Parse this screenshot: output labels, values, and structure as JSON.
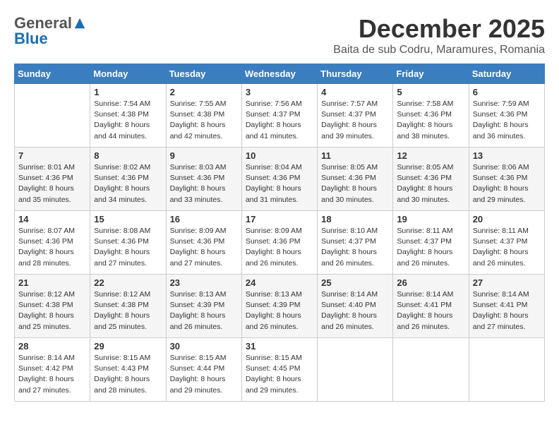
{
  "header": {
    "logo_general": "General",
    "logo_blue": "Blue",
    "month_title": "December 2025",
    "subtitle": "Baita de sub Codru, Maramures, Romania"
  },
  "weekdays": [
    "Sunday",
    "Monday",
    "Tuesday",
    "Wednesday",
    "Thursday",
    "Friday",
    "Saturday"
  ],
  "weeks": [
    [
      {
        "day": "",
        "info": ""
      },
      {
        "day": "1",
        "info": "Sunrise: 7:54 AM\nSunset: 4:38 PM\nDaylight: 8 hours\nand 44 minutes."
      },
      {
        "day": "2",
        "info": "Sunrise: 7:55 AM\nSunset: 4:38 PM\nDaylight: 8 hours\nand 42 minutes."
      },
      {
        "day": "3",
        "info": "Sunrise: 7:56 AM\nSunset: 4:37 PM\nDaylight: 8 hours\nand 41 minutes."
      },
      {
        "day": "4",
        "info": "Sunrise: 7:57 AM\nSunset: 4:37 PM\nDaylight: 8 hours\nand 39 minutes."
      },
      {
        "day": "5",
        "info": "Sunrise: 7:58 AM\nSunset: 4:36 PM\nDaylight: 8 hours\nand 38 minutes."
      },
      {
        "day": "6",
        "info": "Sunrise: 7:59 AM\nSunset: 4:36 PM\nDaylight: 8 hours\nand 36 minutes."
      }
    ],
    [
      {
        "day": "7",
        "info": "Sunrise: 8:01 AM\nSunset: 4:36 PM\nDaylight: 8 hours\nand 35 minutes."
      },
      {
        "day": "8",
        "info": "Sunrise: 8:02 AM\nSunset: 4:36 PM\nDaylight: 8 hours\nand 34 minutes."
      },
      {
        "day": "9",
        "info": "Sunrise: 8:03 AM\nSunset: 4:36 PM\nDaylight: 8 hours\nand 33 minutes."
      },
      {
        "day": "10",
        "info": "Sunrise: 8:04 AM\nSunset: 4:36 PM\nDaylight: 8 hours\nand 31 minutes."
      },
      {
        "day": "11",
        "info": "Sunrise: 8:05 AM\nSunset: 4:36 PM\nDaylight: 8 hours\nand 30 minutes."
      },
      {
        "day": "12",
        "info": "Sunrise: 8:05 AM\nSunset: 4:36 PM\nDaylight: 8 hours\nand 30 minutes."
      },
      {
        "day": "13",
        "info": "Sunrise: 8:06 AM\nSunset: 4:36 PM\nDaylight: 8 hours\nand 29 minutes."
      }
    ],
    [
      {
        "day": "14",
        "info": "Sunrise: 8:07 AM\nSunset: 4:36 PM\nDaylight: 8 hours\nand 28 minutes."
      },
      {
        "day": "15",
        "info": "Sunrise: 8:08 AM\nSunset: 4:36 PM\nDaylight: 8 hours\nand 27 minutes."
      },
      {
        "day": "16",
        "info": "Sunrise: 8:09 AM\nSunset: 4:36 PM\nDaylight: 8 hours\nand 27 minutes."
      },
      {
        "day": "17",
        "info": "Sunrise: 8:09 AM\nSunset: 4:36 PM\nDaylight: 8 hours\nand 26 minutes."
      },
      {
        "day": "18",
        "info": "Sunrise: 8:10 AM\nSunset: 4:37 PM\nDaylight: 8 hours\nand 26 minutes."
      },
      {
        "day": "19",
        "info": "Sunrise: 8:11 AM\nSunset: 4:37 PM\nDaylight: 8 hours\nand 26 minutes."
      },
      {
        "day": "20",
        "info": "Sunrise: 8:11 AM\nSunset: 4:37 PM\nDaylight: 8 hours\nand 26 minutes."
      }
    ],
    [
      {
        "day": "21",
        "info": "Sunrise: 8:12 AM\nSunset: 4:38 PM\nDaylight: 8 hours\nand 25 minutes."
      },
      {
        "day": "22",
        "info": "Sunrise: 8:12 AM\nSunset: 4:38 PM\nDaylight: 8 hours\nand 25 minutes."
      },
      {
        "day": "23",
        "info": "Sunrise: 8:13 AM\nSunset: 4:39 PM\nDaylight: 8 hours\nand 26 minutes."
      },
      {
        "day": "24",
        "info": "Sunrise: 8:13 AM\nSunset: 4:39 PM\nDaylight: 8 hours\nand 26 minutes."
      },
      {
        "day": "25",
        "info": "Sunrise: 8:14 AM\nSunset: 4:40 PM\nDaylight: 8 hours\nand 26 minutes."
      },
      {
        "day": "26",
        "info": "Sunrise: 8:14 AM\nSunset: 4:41 PM\nDaylight: 8 hours\nand 26 minutes."
      },
      {
        "day": "27",
        "info": "Sunrise: 8:14 AM\nSunset: 4:41 PM\nDaylight: 8 hours\nand 27 minutes."
      }
    ],
    [
      {
        "day": "28",
        "info": "Sunrise: 8:14 AM\nSunset: 4:42 PM\nDaylight: 8 hours\nand 27 minutes."
      },
      {
        "day": "29",
        "info": "Sunrise: 8:15 AM\nSunset: 4:43 PM\nDaylight: 8 hours\nand 28 minutes."
      },
      {
        "day": "30",
        "info": "Sunrise: 8:15 AM\nSunset: 4:44 PM\nDaylight: 8 hours\nand 29 minutes."
      },
      {
        "day": "31",
        "info": "Sunrise: 8:15 AM\nSunset: 4:45 PM\nDaylight: 8 hours\nand 29 minutes."
      },
      {
        "day": "",
        "info": ""
      },
      {
        "day": "",
        "info": ""
      },
      {
        "day": "",
        "info": ""
      }
    ]
  ]
}
